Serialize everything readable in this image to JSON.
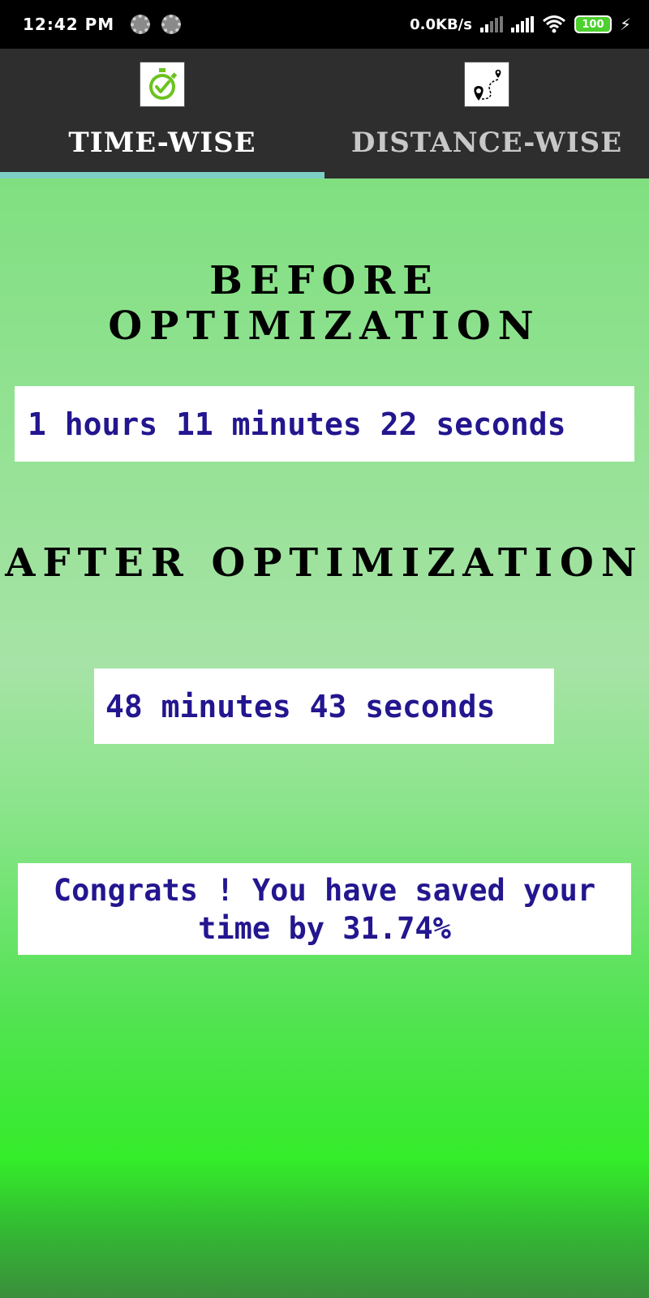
{
  "status_bar": {
    "time": "12:42 PM",
    "network_speed": "0.0KB/s",
    "battery": "100",
    "icons": [
      "loading-icon",
      "loading-icon",
      "signal-icon",
      "signal-icon",
      "wifi-icon",
      "battery-icon",
      "charging-icon"
    ]
  },
  "tabs": [
    {
      "label": "TIME-WISE",
      "icon": "stopwatch-check-icon",
      "active": true
    },
    {
      "label": "DISTANCE-WISE",
      "icon": "route-pin-icon",
      "active": false
    }
  ],
  "colors": {
    "tab_bar": "#2e2e2e",
    "tab_indicator": "#7ecfc4",
    "value_text": "#23168f",
    "heading_text": "#000000"
  },
  "main": {
    "before_heading": "BEFORE OPTIMIZATION",
    "before_value": "1 hours 11 minutes 22 seconds",
    "after_heading": "AFTER OPTIMIZATION",
    "after_value": "48 minutes 43 seconds",
    "congrats_line1": "Congrats ! You have saved your",
    "congrats_line2": "time by 31.74%"
  }
}
